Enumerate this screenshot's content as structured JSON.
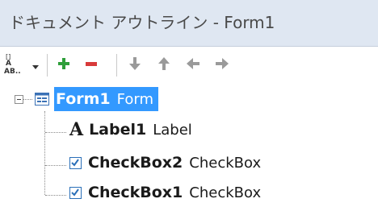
{
  "window": {
    "title": "ドキュメント アウトライン - Form1"
  },
  "toolbar": {
    "icons": [
      "sort-az-icon",
      "add-icon",
      "remove-icon",
      "move-down-icon",
      "move-up-icon",
      "move-left-icon",
      "move-right-icon"
    ],
    "colors": {
      "add": "#2f9e3a",
      "remove": "#d83a3a",
      "arrow": "#9a9a9a"
    }
  },
  "tree": {
    "root": {
      "name": "Form1",
      "type": "Form",
      "icon": "form-icon"
    },
    "children": [
      {
        "name": "Label1",
        "type": "Label",
        "icon": "label-icon"
      },
      {
        "name": "CheckBox2",
        "type": "CheckBox",
        "icon": "checkbox-icon"
      },
      {
        "name": "CheckBox1",
        "type": "CheckBox",
        "icon": "checkbox-icon"
      }
    ]
  },
  "colors": {
    "selection": "#3399ff",
    "titlebar": "#dfe7f2"
  }
}
